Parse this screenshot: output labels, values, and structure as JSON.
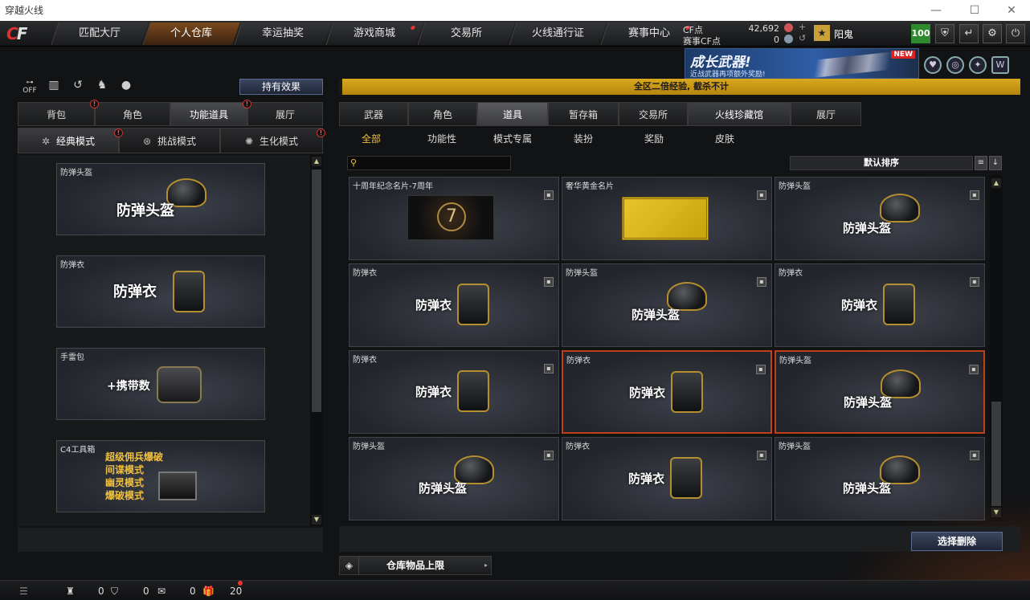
{
  "window": {
    "title": "穿越火线"
  },
  "topnav": {
    "tabs": [
      "匹配大厅",
      "个人仓库",
      "幸运抽奖",
      "游戏商城",
      "交易所",
      "火线通行证",
      "赛事中心"
    ]
  },
  "currency": {
    "cf_label": "CF点",
    "cf_value": "42,692",
    "event_label": "赛事CF点",
    "event_value": "0"
  },
  "user": {
    "name": "阳鬼",
    "level": "100"
  },
  "banner": {
    "title": "成长武器!",
    "subtitle": "近战武器再项额外奖励!",
    "badge": "NEW"
  },
  "left": {
    "hold_effect": "持有效果",
    "tabs": [
      "背包",
      "角色",
      "功能道具",
      "展厅"
    ],
    "modes": [
      "经典模式",
      "挑战模式",
      "生化模式"
    ],
    "cards": [
      {
        "caption": "防弹头盔",
        "name": "防弹头盔"
      },
      {
        "caption": "防弹衣",
        "name": "防弹衣"
      },
      {
        "caption": "手雷包",
        "name": "+携带数"
      },
      {
        "caption": "C4工具箱",
        "lines": [
          "超级佣兵爆破",
          "间谍模式",
          "幽灵模式",
          "爆破模式"
        ]
      }
    ]
  },
  "notice": {
    "text": "全区二倍经验, 截杀不计"
  },
  "right": {
    "tabs": [
      "武器",
      "角色",
      "道具",
      "暂存箱",
      "交易所",
      "火线珍藏馆",
      "展厅"
    ],
    "subtabs": [
      "全部",
      "功能性",
      "模式专属",
      "装扮",
      "奖励",
      "皮肤"
    ],
    "search_placeholder": "",
    "sort_label": "默认排序",
    "items": [
      {
        "caption": "十周年纪念名片-7周年",
        "name": ""
      },
      {
        "caption": "奢华黄金名片",
        "name": ""
      },
      {
        "caption": "防弹头盔",
        "name": "防弹头盔"
      },
      {
        "caption": "防弹衣",
        "name": "防弹衣"
      },
      {
        "caption": "防弹头盔",
        "name": "防弹头盔"
      },
      {
        "caption": "防弹衣",
        "name": "防弹衣"
      },
      {
        "caption": "防弹衣",
        "name": "防弹衣"
      },
      {
        "caption": "防弹衣",
        "name": "防弹衣"
      },
      {
        "caption": "防弹头盔",
        "name": "防弹头盔"
      },
      {
        "caption": "防弹头盔",
        "name": "防弹头盔"
      },
      {
        "caption": "防弹衣",
        "name": "防弹衣"
      },
      {
        "caption": "防弹头盔",
        "name": "防弹头盔"
      }
    ],
    "delete_button": "选择删除",
    "storage_limit": "仓库物品上限"
  },
  "status": {
    "friends": "0",
    "guild": "0",
    "chat": "0",
    "gift": "20"
  }
}
